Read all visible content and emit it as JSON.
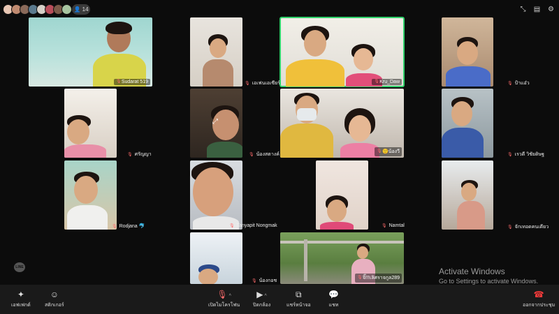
{
  "topbar": {
    "participant_count": "14",
    "participant_icon": "person-icon",
    "icons": [
      "shrink-icon",
      "layout-icon",
      "settings-icon"
    ]
  },
  "tiles": {
    "t1": {
      "name": "Sudarat 519"
    },
    "t2": {
      "name": "เอเฟนเอเซียร์"
    },
    "t3": {
      "name": "Kru_Daw"
    },
    "t5": {
      "name": "น้องสตางค์"
    },
    "t6": {
      "name": "🙂น้องวี"
    },
    "t8": {
      "name": "Rodjana 🐬"
    },
    "t9": {
      "name": "Tanyapit Nongmak"
    },
    "t10": {
      "name": "Namtal"
    },
    "t11": {
      "name": "น้องกอช"
    },
    "t12": {
      "name": "จิ๊!!!เลิศราจกูล289"
    }
  },
  "external_labels": {
    "e1": "ป้าแอ๋ว",
    "e2": "ศรัญญา",
    "e3": "เรวดี วิชัยดิษฐ",
    "e4": "จักเทอดคนเดียว"
  },
  "watermark": {
    "line1": "Activate Windows",
    "line2": "Go to Settings to activate Windows."
  },
  "bottombar": {
    "effects": "เอฟเฟกต์",
    "stickers": "สติกเกอร์",
    "mic": "เปิดไมโครโฟน",
    "camera": "ปิดกล้อง",
    "share": "แชร์หน้าจอ",
    "chat": "แชท",
    "leave": "ออกจากประชุม"
  },
  "colors": {
    "active_speaker": "#2fd06a",
    "leave": "#ff3b3b",
    "muted": "#ff6b6b"
  }
}
